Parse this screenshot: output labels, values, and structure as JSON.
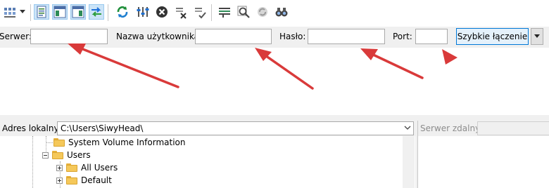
{
  "toolbar": {
    "icons": [
      "site-manager-icon",
      "dropdown-arrow-icon",
      "message-log-icon",
      "local-tree-icon",
      "remote-tree-icon",
      "transfer-queue-icon",
      "refresh-icon",
      "process-queue-icon",
      "cancel-icon",
      "disconnect-icon",
      "reconnect-icon",
      "directory-filter-icon",
      "search-icon",
      "sync-browse-icon",
      "compare-icon"
    ]
  },
  "quickconnect": {
    "host_label": "Serwer:",
    "host_value": "",
    "user_label": "Nazwa użytkownika:",
    "user_value": "",
    "pass_label": "Hasło:",
    "pass_value": "",
    "port_label": "Port:",
    "port_value": "",
    "connect_button": "Szybkie łączenie"
  },
  "local": {
    "label": "Adres lokalny:",
    "path": "C:\\Users\\SiwyHead\\",
    "tree": [
      {
        "name": "System Volume Information"
      },
      {
        "name": "Users"
      },
      {
        "name": "All Users"
      },
      {
        "name": "Default"
      }
    ]
  },
  "remote": {
    "label": "Serwer zdalny:",
    "path": ""
  },
  "colors": {
    "annotation_arrow": "#d93a3a",
    "accent": "#0078d7"
  }
}
